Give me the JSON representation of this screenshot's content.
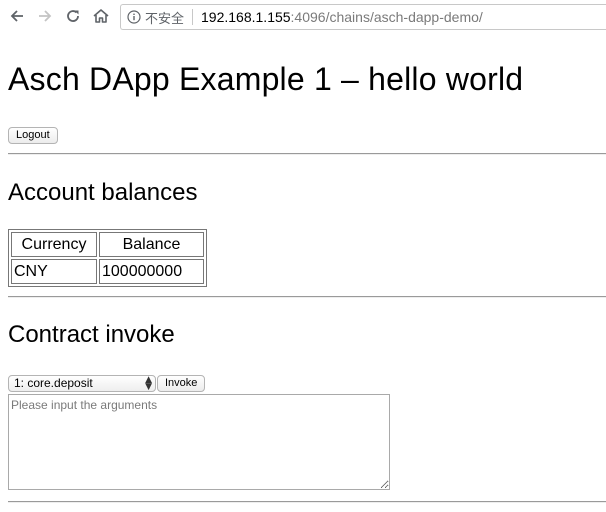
{
  "browser": {
    "security_label": "不安全",
    "url_host": "192.168.1.155",
    "url_path": ":4096/chains/asch-dapp-demo/"
  },
  "page": {
    "title": "Asch DApp Example 1 – hello world",
    "logout_label": "Logout",
    "balances_heading": "Account balances",
    "balances_table": {
      "headers": [
        "Currency",
        "Balance"
      ],
      "rows": [
        [
          "CNY",
          "100000000"
        ]
      ]
    },
    "contract_heading": "Contract invoke",
    "contract_select_value": "1: core.deposit",
    "invoke_label": "Invoke",
    "args_placeholder": "Please input the arguments"
  }
}
